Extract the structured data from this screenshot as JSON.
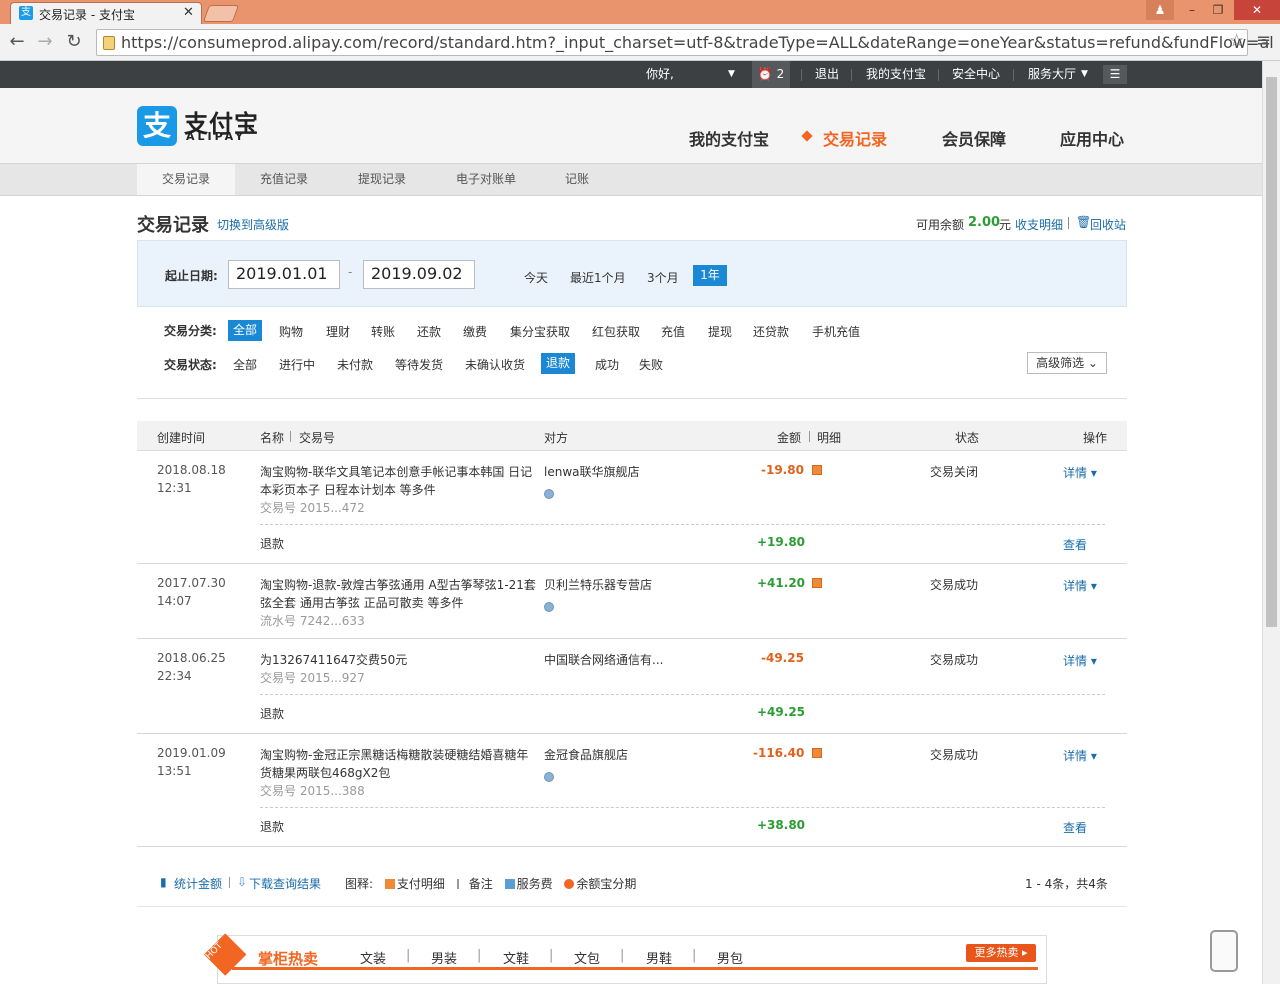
{
  "browser": {
    "tab_title": "交易记录 - 支付宝",
    "url": "https://consumeprod.alipay.com/record/standard.htm?_input_charset=utf-8&tradeType=ALL&dateRange=oneYear&status=refund&fundFlow=al"
  },
  "sitebar": {
    "greeting": "你好,",
    "alarm_count": "2",
    "logout": "退出",
    "my_alipay": "我的支付宝",
    "security": "安全中心",
    "service": "服务大厅"
  },
  "header": {
    "logo_cn": "支付宝",
    "logo_en": "ALIPAY",
    "logo_mark": "支",
    "nav": [
      "我的支付宝",
      "交易记录",
      "会员保障",
      "应用中心"
    ]
  },
  "subnav": [
    "交易记录",
    "充值记录",
    "提现记录",
    "电子对账单",
    "记账"
  ],
  "page": {
    "title": "交易记录",
    "switch_link": "切换到高级版",
    "balance_label": "可用余额",
    "balance_value": "2.00",
    "balance_unit": "元",
    "balance_detail": "收支明细",
    "recycle": "回收站"
  },
  "filters": {
    "date_label": "起止日期:",
    "date_from": "2019.01.01",
    "date_to": "2019.09.02",
    "date_dash": "-",
    "quick": [
      "今天",
      "最近1个月",
      "3个月",
      "1年"
    ],
    "category_label": "交易分类:",
    "categories": [
      "全部",
      "购物",
      "理财",
      "转账",
      "还款",
      "缴费",
      "集分宝获取",
      "红包获取",
      "充值",
      "提现",
      "还贷款",
      "手机充值"
    ],
    "status_label": "交易状态:",
    "statuses": [
      "全部",
      "进行中",
      "未付款",
      "等待发货",
      "未确认收货",
      "退款",
      "成功",
      "失败"
    ],
    "advanced": "高级筛选 ⌄"
  },
  "table": {
    "headers": {
      "time": "创建时间",
      "name": "名称",
      "tradeno": "交易号",
      "peer": "对方",
      "amount": "金额",
      "detail": "明细",
      "status": "状态",
      "action": "操作"
    },
    "rows": [
      {
        "date": "2018.08.18",
        "time": "12:31",
        "name_l1": "淘宝购物-联华文具笔记本创意手帐记事本韩国 日记",
        "name_l2": "本彩页本子 日程本计划本 等多件",
        "tradeno": "交易号 2015...472",
        "peer": "lenwa联华旗舰店",
        "amount": "-19.80",
        "status": "交易关闭",
        "action": "详情 ▾",
        "sub_label": "退款",
        "sub_amount": "+19.80",
        "sub_action": "查看"
      },
      {
        "date": "2017.07.30",
        "time": "14:07",
        "name_l1": "淘宝购物-退款-敦煌古筝弦通用 A型古筝琴弦1-21套",
        "name_l2": "弦全套 通用古筝弦 正品可散卖 等多件",
        "tradeno": "流水号 7242...633",
        "peer": "贝利兰特乐器专营店",
        "amount": "+41.20",
        "status": "交易成功",
        "action": "详情 ▾"
      },
      {
        "date": "2018.06.25",
        "time": "22:34",
        "name_l1": "为13267411647交费50元",
        "tradeno": "交易号 2015...927",
        "peer": "中国联合网络通信有...",
        "amount": "-49.25",
        "status": "交易成功",
        "action": "详情 ▾",
        "sub_label": "退款",
        "sub_amount": "+49.25"
      },
      {
        "date": "2019.01.09",
        "time": "13:51",
        "name_l1": "淘宝购物-金冠正宗黑糖话梅糖散装硬糖结婚喜糖年",
        "name_l2": "货糖果两联包468gX2包",
        "tradeno": "交易号 2015...388",
        "peer": "金冠食品旗舰店",
        "amount": "-116.40",
        "status": "交易成功",
        "action": "详情 ▾",
        "sub_label": "退款",
        "sub_amount": "+38.80",
        "sub_action": "查看"
      }
    ]
  },
  "footer": {
    "stat": "统计金额",
    "download": "下载查询结果",
    "legend_label": "图释:",
    "legend": [
      "支付明细",
      "备注",
      "服务费",
      "余额宝分期"
    ],
    "pager": "1 - 4条，共4条"
  },
  "ad": {
    "hot": "HOT",
    "title": "掌柜热卖",
    "cats": [
      "文装",
      "男装",
      "文鞋",
      "文包",
      "男鞋",
      "男包"
    ],
    "seps": [
      "|",
      "|",
      "|",
      "|",
      "|"
    ],
    "more": "更多热卖 ▸"
  },
  "icons": [
    "user-icon",
    "minimize-icon",
    "restore-icon",
    "close-icon",
    "back-icon",
    "forward-icon",
    "reload-icon",
    "lock-icon",
    "star-icon",
    "menu-icon",
    "alarm-icon",
    "list-icon",
    "trash-icon",
    "chart-icon",
    "download-icon",
    "phone-icon"
  ],
  "colors": {
    "accent": "#f26522",
    "link": "#1a6ca8",
    "active": "#1a88d4",
    "positive": "#2b9d34",
    "negative": "#e0611a"
  }
}
